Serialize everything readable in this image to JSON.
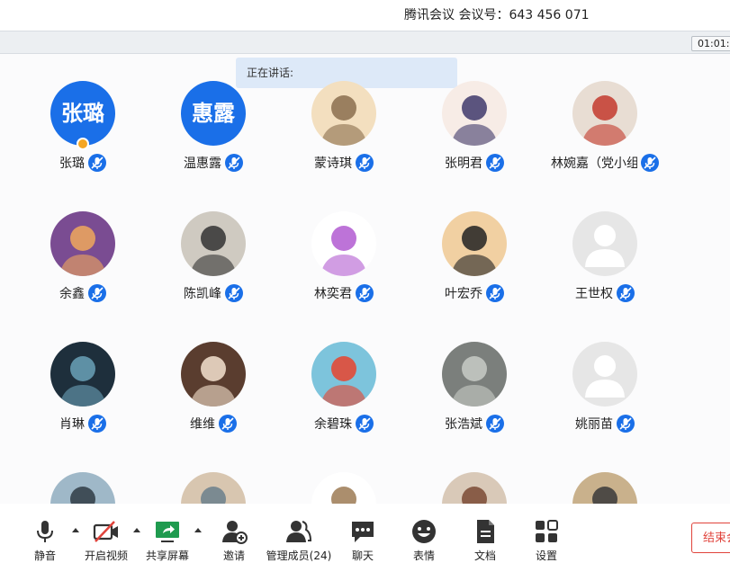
{
  "window": {
    "title": "腾讯会议 会议号：643 456 071",
    "timer": "01:01:"
  },
  "speaking_label": "正在讲话:",
  "participants": [
    {
      "name": "张璐",
      "avatar_text": "张璐",
      "avatar_kind": "text",
      "host": true
    },
    {
      "name": "温惠露",
      "avatar_text": "惠露",
      "avatar_kind": "text"
    },
    {
      "name": "蒙诗琪",
      "avatar_kind": "photo",
      "colors": [
        "#f3dfbf",
        "#8a6e4d"
      ]
    },
    {
      "name": "张明君",
      "avatar_kind": "photo",
      "colors": [
        "#f7ece6",
        "#3f3a6b"
      ]
    },
    {
      "name": "林婉嘉（党小组...",
      "avatar_kind": "photo",
      "colors": [
        "#e8ddd3",
        "#c33a2d"
      ]
    },
    {
      "name": "余鑫",
      "avatar_kind": "photo",
      "colors": [
        "#7a4c92",
        "#f0a85c"
      ]
    },
    {
      "name": "陈凯峰",
      "avatar_kind": "photo",
      "colors": [
        "#cfcac1",
        "#333333"
      ]
    },
    {
      "name": "林奕君",
      "avatar_kind": "photo",
      "colors": [
        "#ffffff",
        "#b25bd1"
      ]
    },
    {
      "name": "叶宏乔",
      "avatar_kind": "photo",
      "colors": [
        "#f1d0a2",
        "#222222"
      ]
    },
    {
      "name": "王世权",
      "avatar_kind": "default"
    },
    {
      "name": "肖琳",
      "avatar_kind": "photo",
      "colors": [
        "#1e2f3c",
        "#6aa1b7"
      ]
    },
    {
      "name": "维维",
      "avatar_kind": "photo",
      "colors": [
        "#5a3d2f",
        "#f5e2cf"
      ]
    },
    {
      "name": "余碧珠",
      "avatar_kind": "photo",
      "colors": [
        "#7dc4dc",
        "#e8442e"
      ]
    },
    {
      "name": "张浩斌",
      "avatar_kind": "photo",
      "colors": [
        "#7b7f7c",
        "#c8cbc7"
      ]
    },
    {
      "name": "姚丽苗",
      "avatar_kind": "default"
    },
    {
      "name": "",
      "avatar_kind": "photo",
      "colors": [
        "#9fb8c8",
        "#2f3b44"
      ]
    },
    {
      "name": "",
      "avatar_kind": "photo",
      "colors": [
        "#d8c6b0",
        "#6b7f8c"
      ]
    },
    {
      "name": "",
      "avatar_kind": "photo",
      "colors": [
        "#ffffff",
        "#9c7a54"
      ]
    },
    {
      "name": "",
      "avatar_kind": "photo",
      "colors": [
        "#d9c9b8",
        "#7a4a34"
      ]
    },
    {
      "name": "",
      "avatar_kind": "photo",
      "colors": [
        "#c9b18c",
        "#3a3a3a"
      ]
    }
  ],
  "toolbar": {
    "mute": "静音",
    "video": "开启视频",
    "share": "共享屏幕",
    "invite": "邀请",
    "members": "管理成员(24)",
    "chat": "聊天",
    "emoji": "表情",
    "docs": "文档",
    "settings": "设置",
    "end": "结束会议"
  },
  "colors": {
    "accent": "#1a6fe8",
    "end": "#e0433b",
    "share": "#1f9b4f"
  }
}
